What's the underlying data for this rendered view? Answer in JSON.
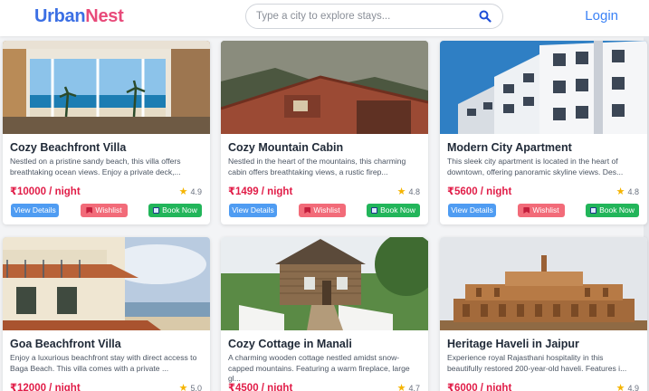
{
  "brand": {
    "part1": "Urban",
    "part2": "Nest"
  },
  "search": {
    "placeholder": "Type a city to explore stays..."
  },
  "nav": {
    "login": "Login"
  },
  "buttons": {
    "view": "View Details",
    "wishlist": "Wishlist",
    "book": "Book Now"
  },
  "listings": [
    {
      "title": "Cozy Beachfront Villa",
      "description": "Nestled on a pristine sandy beach, this villa offers breathtaking ocean views. Enjoy a private deck,...",
      "price": "₹10000 / night",
      "rating": "4.9"
    },
    {
      "title": "Cozy Mountain Cabin",
      "description": "Nestled in the heart of the mountains, this charming cabin offers breathtaking views, a rustic firep...",
      "price": "₹1499 / night",
      "rating": "4.8"
    },
    {
      "title": "Modern City Apartment",
      "description": "This sleek city apartment is located in the heart of downtown, offering panoramic skyline views. Des...",
      "price": "₹5600 / night",
      "rating": "4.8"
    },
    {
      "title": "Goa Beachfront Villa",
      "description": "Enjoy a luxurious beachfront stay with direct access to Baga Beach. This villa comes with a private ...",
      "price": "₹12000 / night",
      "rating": "5.0"
    },
    {
      "title": "Cozy Cottage in Manali",
      "description": "A charming wooden cottage nestled amidst snow-capped mountains. Featuring a warm fireplace, large gl...",
      "price": "₹4500 / night",
      "rating": "4.7"
    },
    {
      "title": "Heritage Haveli in Jaipur",
      "description": "Experience royal Rajasthani hospitality in this beautifully restored 200-year-old haveli. Features i...",
      "price": "₹6000 / night",
      "rating": "4.9"
    }
  ]
}
